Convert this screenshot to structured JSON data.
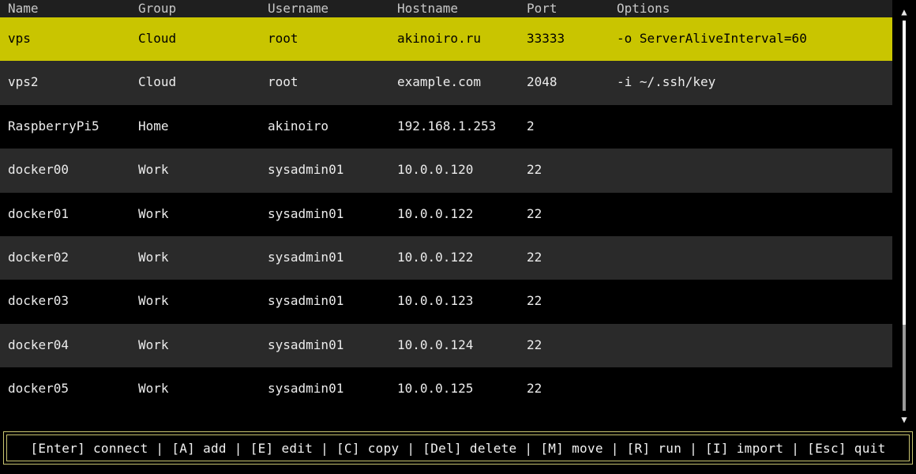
{
  "columns": [
    "Name",
    "Group",
    "Username",
    "Hostname",
    "Port",
    "Options"
  ],
  "rows": [
    {
      "name": "vps",
      "group": "Cloud",
      "username": "root",
      "hostname": "akinoiro.ru",
      "port": "33333",
      "options": "-o ServerAliveInterval=60",
      "selected": true
    },
    {
      "name": "vps2",
      "group": "Cloud",
      "username": "root",
      "hostname": "example.com",
      "port": "2048",
      "options": "-i ~/.ssh/key",
      "selected": false
    },
    {
      "name": "RaspberryPi5",
      "group": "Home",
      "username": "akinoiro",
      "hostname": "192.168.1.253",
      "port": "2",
      "options": "",
      "selected": false
    },
    {
      "name": "docker00",
      "group": "Work",
      "username": "sysadmin01",
      "hostname": "10.0.0.120",
      "port": "22",
      "options": "",
      "selected": false
    },
    {
      "name": "docker01",
      "group": "Work",
      "username": "sysadmin01",
      "hostname": "10.0.0.122",
      "port": "22",
      "options": "",
      "selected": false
    },
    {
      "name": "docker02",
      "group": "Work",
      "username": "sysadmin01",
      "hostname": "10.0.0.122",
      "port": "22",
      "options": "",
      "selected": false
    },
    {
      "name": "docker03",
      "group": "Work",
      "username": "sysadmin01",
      "hostname": "10.0.0.123",
      "port": "22",
      "options": "",
      "selected": false
    },
    {
      "name": "docker04",
      "group": "Work",
      "username": "sysadmin01",
      "hostname": "10.0.0.124",
      "port": "22",
      "options": "",
      "selected": false
    },
    {
      "name": "docker05",
      "group": "Work",
      "username": "sysadmin01",
      "hostname": "10.0.0.125",
      "port": "22",
      "options": "",
      "selected": false
    }
  ],
  "scrollbar": {
    "up_arrow": "▲",
    "down_arrow": "▼",
    "thumb_fraction": 0.78
  },
  "statusbar": {
    "shortcuts": [
      {
        "key": "[Enter]",
        "action": "connect"
      },
      {
        "key": "[A]",
        "action": "add"
      },
      {
        "key": "[E]",
        "action": "edit"
      },
      {
        "key": "[C]",
        "action": "copy"
      },
      {
        "key": "[Del]",
        "action": "delete"
      },
      {
        "key": "[M]",
        "action": "move"
      },
      {
        "key": "[R]",
        "action": "run"
      },
      {
        "key": "[I]",
        "action": "import"
      },
      {
        "key": "[Esc]",
        "action": "quit"
      }
    ],
    "separator": " | "
  },
  "colors": {
    "selected_bg": "#c9c500",
    "alt_row_bg": "#2a2a2a",
    "border": "#c9c570"
  }
}
